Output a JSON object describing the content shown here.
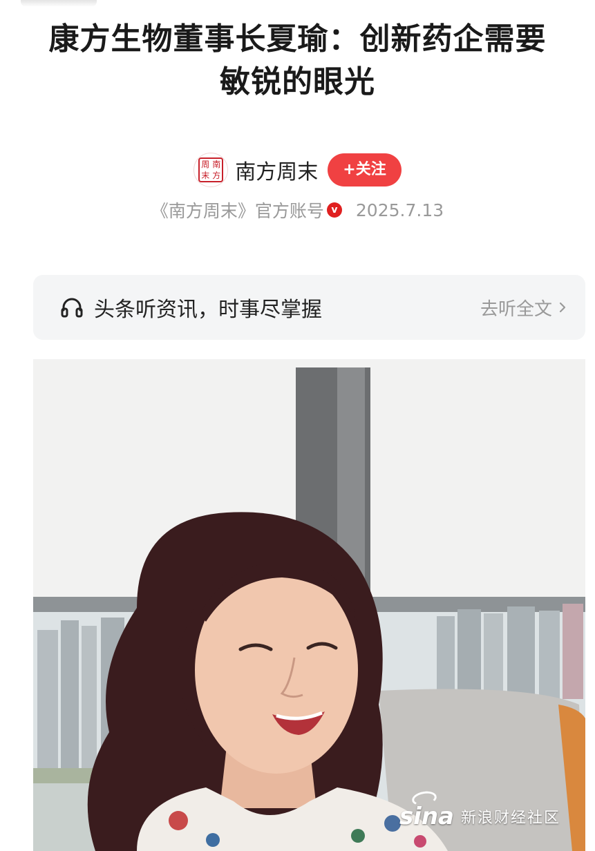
{
  "article": {
    "title": "康方生物董事长夏瑜：创新药企需要敏锐的眼光"
  },
  "author": {
    "avatar_chars": [
      "周",
      "南",
      "末",
      "方"
    ],
    "name": "南方周末",
    "follow_label": "+关注",
    "account_desc": "《南方周末》官方账号",
    "verified_mark": "v",
    "date": "2025.7.13"
  },
  "listen": {
    "icon": "headphone-icon",
    "text": "头条听资讯，时事尽掌握",
    "link_label": "去听全文"
  },
  "photo": {
    "watermark_logo": "sina",
    "watermark_text": "新浪财经社区"
  },
  "colors": {
    "accent": "#f04142",
    "verified": "#e02020",
    "muted_text": "#999999",
    "bar_bg": "#f4f5f6"
  }
}
